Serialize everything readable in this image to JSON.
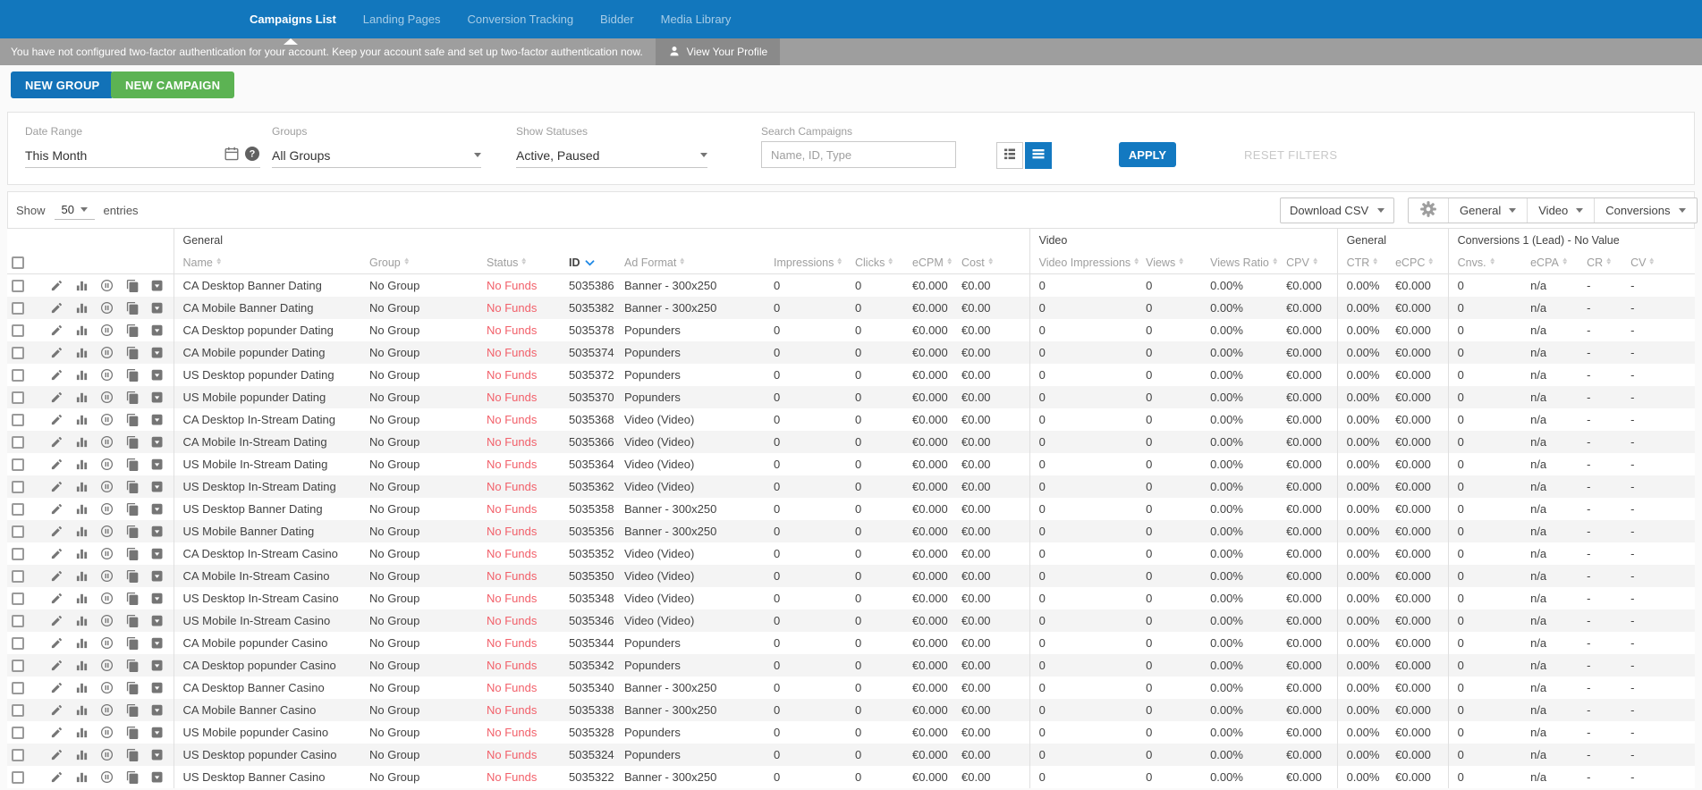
{
  "colors": {
    "topbar_blue": "#1277bd",
    "accent_blue": "#1379c1",
    "button_green": "#5cb353",
    "status_red": "#f2606a",
    "sorted_blue": "#1e88e5",
    "notification_gray": "#9e9e9e"
  },
  "topnav": {
    "items": [
      {
        "label": "Campaigns List",
        "active": true
      },
      {
        "label": "Landing Pages",
        "active": false
      },
      {
        "label": "Conversion Tracking",
        "active": false
      },
      {
        "label": "Bidder",
        "active": false
      },
      {
        "label": "Media Library",
        "active": false
      }
    ]
  },
  "notification": {
    "message": "You have not configured two-factor authentication for your account. Keep your account safe and set up two-factor authentication now.",
    "profile_button": "View Your Profile"
  },
  "header_actions": {
    "new_group": "NEW GROUP",
    "new_campaign": "NEW CAMPAIGN"
  },
  "filters": {
    "date_range": {
      "label": "Date Range",
      "value": "This Month"
    },
    "groups": {
      "label": "Groups",
      "value": "All Groups"
    },
    "statuses": {
      "label": "Show Statuses",
      "value": "Active, Paused"
    },
    "search": {
      "label": "Search Campaigns",
      "placeholder": "Name, ID, Type"
    },
    "apply_label": "APPLY",
    "reset_label": "RESET FILTERS"
  },
  "toolbar": {
    "show_label": "Show",
    "page_size": "50",
    "entries_label": "entries",
    "download_csv_label": "Download CSV",
    "column_menus": [
      {
        "label": "General"
      },
      {
        "label": "Video"
      },
      {
        "label": "Conversions"
      }
    ]
  },
  "table": {
    "column_groups": [
      {
        "label": "",
        "span": 2
      },
      {
        "label": "General",
        "span": 9
      },
      {
        "label": "Video",
        "span": 4
      },
      {
        "label": "General",
        "span": 2
      },
      {
        "label": "Conversions 1 (Lead) - No Value",
        "span": 4
      }
    ],
    "columns": [
      {
        "label": "Name",
        "sortable": true
      },
      {
        "label": "Group",
        "sortable": true
      },
      {
        "label": "Status",
        "sortable": true
      },
      {
        "label": "ID",
        "sortable": true,
        "sorted": "desc"
      },
      {
        "label": "Ad Format",
        "sortable": true
      },
      {
        "label": "Impressions",
        "sortable": true
      },
      {
        "label": "Clicks",
        "sortable": true
      },
      {
        "label": "eCPM",
        "sortable": true
      },
      {
        "label": "Cost",
        "sortable": true
      },
      {
        "label": "Video Impressions",
        "sortable": true
      },
      {
        "label": "Views",
        "sortable": true
      },
      {
        "label": "Views Ratio",
        "sortable": true
      },
      {
        "label": "CPV",
        "sortable": true
      },
      {
        "label": "CTR",
        "sortable": true
      },
      {
        "label": "eCPC",
        "sortable": true
      },
      {
        "label": "Cnvs.",
        "sortable": true
      },
      {
        "label": "eCPA",
        "sortable": true
      },
      {
        "label": "CR",
        "sortable": true
      },
      {
        "label": "CV",
        "sortable": true
      }
    ],
    "row_action_icons": [
      "edit",
      "stats",
      "pause",
      "copy",
      "move-to"
    ],
    "shared": {
      "group": "No Group",
      "status": "No Funds",
      "impressions": "0",
      "clicks": "0",
      "ecpm": "€0.000",
      "cost": "€0.00",
      "video_impressions": "0",
      "views": "0",
      "views_ratio": "0.00%",
      "cpv": "€0.000",
      "ctr": "0.00%",
      "ecpc": "€0.000",
      "cnvs": "0",
      "ecpa": "n/a",
      "cr": "-",
      "cv": "-"
    },
    "rows": [
      {
        "name": "CA Desktop Banner Dating",
        "id": "5035386",
        "ad_format": "Banner - 300x250"
      },
      {
        "name": "CA Mobile Banner Dating",
        "id": "5035382",
        "ad_format": "Banner - 300x250"
      },
      {
        "name": "CA Desktop popunder Dating",
        "id": "5035378",
        "ad_format": "Popunders"
      },
      {
        "name": "CA Mobile popunder Dating",
        "id": "5035374",
        "ad_format": "Popunders"
      },
      {
        "name": "US Desktop popunder Dating",
        "id": "5035372",
        "ad_format": "Popunders"
      },
      {
        "name": "US Mobile popunder Dating",
        "id": "5035370",
        "ad_format": "Popunders"
      },
      {
        "name": "CA Desktop In-Stream Dating",
        "id": "5035368",
        "ad_format": "Video (Video)"
      },
      {
        "name": "CA Mobile In-Stream Dating",
        "id": "5035366",
        "ad_format": "Video (Video)"
      },
      {
        "name": "US Mobile In-Stream Dating",
        "id": "5035364",
        "ad_format": "Video (Video)"
      },
      {
        "name": "US Desktop In-Stream Dating",
        "id": "5035362",
        "ad_format": "Video (Video)"
      },
      {
        "name": "US Desktop Banner Dating",
        "id": "5035358",
        "ad_format": "Banner - 300x250"
      },
      {
        "name": "US Mobile Banner Dating",
        "id": "5035356",
        "ad_format": "Banner - 300x250"
      },
      {
        "name": "CA Desktop In-Stream Casino",
        "id": "5035352",
        "ad_format": "Video (Video)"
      },
      {
        "name": "CA Mobile In-Stream Casino",
        "id": "5035350",
        "ad_format": "Video (Video)"
      },
      {
        "name": "US Desktop In-Stream Casino",
        "id": "5035348",
        "ad_format": "Video (Video)"
      },
      {
        "name": "US Mobile In-Stream Casino",
        "id": "5035346",
        "ad_format": "Video (Video)"
      },
      {
        "name": "CA Mobile popunder Casino",
        "id": "5035344",
        "ad_format": "Popunders"
      },
      {
        "name": "CA Desktop popunder Casino",
        "id": "5035342",
        "ad_format": "Popunders"
      },
      {
        "name": "CA Desktop Banner Casino",
        "id": "5035340",
        "ad_format": "Banner - 300x250"
      },
      {
        "name": "CA Mobile Banner Casino",
        "id": "5035338",
        "ad_format": "Banner - 300x250"
      },
      {
        "name": "US Mobile popunder Casino",
        "id": "5035328",
        "ad_format": "Popunders"
      },
      {
        "name": "US Desktop popunder Casino",
        "id": "5035324",
        "ad_format": "Popunders"
      },
      {
        "name": "US Desktop Banner Casino",
        "id": "5035322",
        "ad_format": "Banner - 300x250"
      }
    ]
  }
}
